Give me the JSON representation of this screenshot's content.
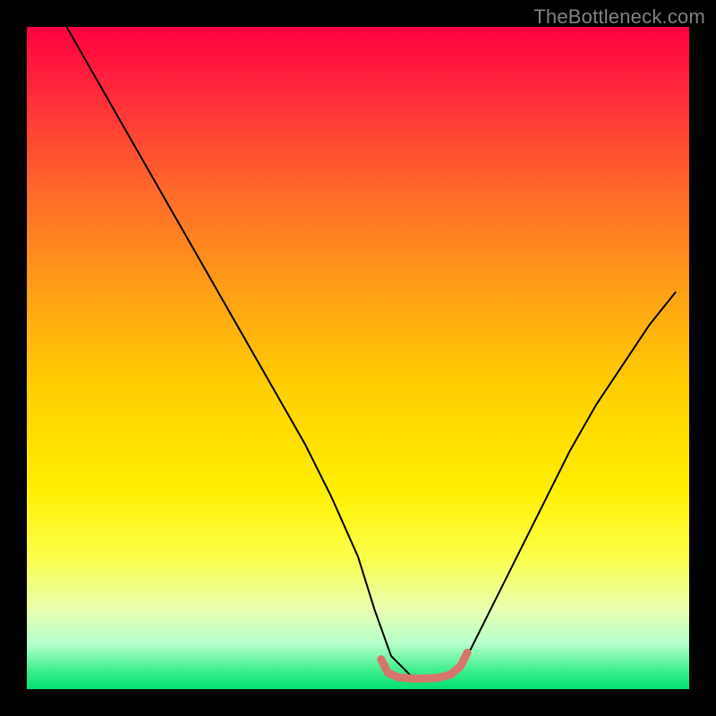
{
  "watermark": "TheBottleneck.com",
  "chart_data": {
    "type": "line",
    "title": "",
    "xlabel": "",
    "ylabel": "",
    "xlim": [
      0,
      100
    ],
    "ylim": [
      0,
      100
    ],
    "grid": false,
    "legend": false,
    "background_gradient": {
      "stops": [
        {
          "pos": 0.0,
          "color": "#ff0040"
        },
        {
          "pos": 0.1,
          "color": "#ff2a3a"
        },
        {
          "pos": 0.25,
          "color": "#ff6a2a"
        },
        {
          "pos": 0.4,
          "color": "#ffa015"
        },
        {
          "pos": 0.55,
          "color": "#ffd000"
        },
        {
          "pos": 0.7,
          "color": "#ffef00"
        },
        {
          "pos": 0.8,
          "color": "#fbff4a"
        },
        {
          "pos": 0.88,
          "color": "#e8ffb0"
        },
        {
          "pos": 0.93,
          "color": "#b8ffcc"
        },
        {
          "pos": 0.97,
          "color": "#44f090"
        },
        {
          "pos": 1.0,
          "color": "#00e070"
        }
      ]
    },
    "series": [
      {
        "name": "bottleneck-curve",
        "color": "#000000",
        "width": 2,
        "x": [
          6,
          10,
          14,
          18,
          22,
          26,
          30,
          34,
          38,
          42,
          46,
          50,
          52.5,
          55,
          58,
          62,
          65,
          67,
          70,
          74,
          78,
          82,
          86,
          90,
          94,
          98
        ],
        "y": [
          100,
          93,
          86,
          79,
          72,
          65,
          58,
          51,
          44,
          37,
          29,
          20,
          12,
          5,
          2,
          2,
          3,
          6,
          12,
          20,
          28,
          36,
          43,
          49,
          55,
          60
        ]
      },
      {
        "name": "optimal-zone-marker",
        "color": "#d8756b",
        "width": 9,
        "linecap": "round",
        "x": [
          53.5,
          54.5,
          56,
          58,
          60,
          62,
          64,
          65.5,
          66.5
        ],
        "y": [
          4.5,
          2.5,
          1.8,
          1.6,
          1.6,
          1.7,
          2.2,
          3.5,
          5.5
        ]
      }
    ]
  }
}
